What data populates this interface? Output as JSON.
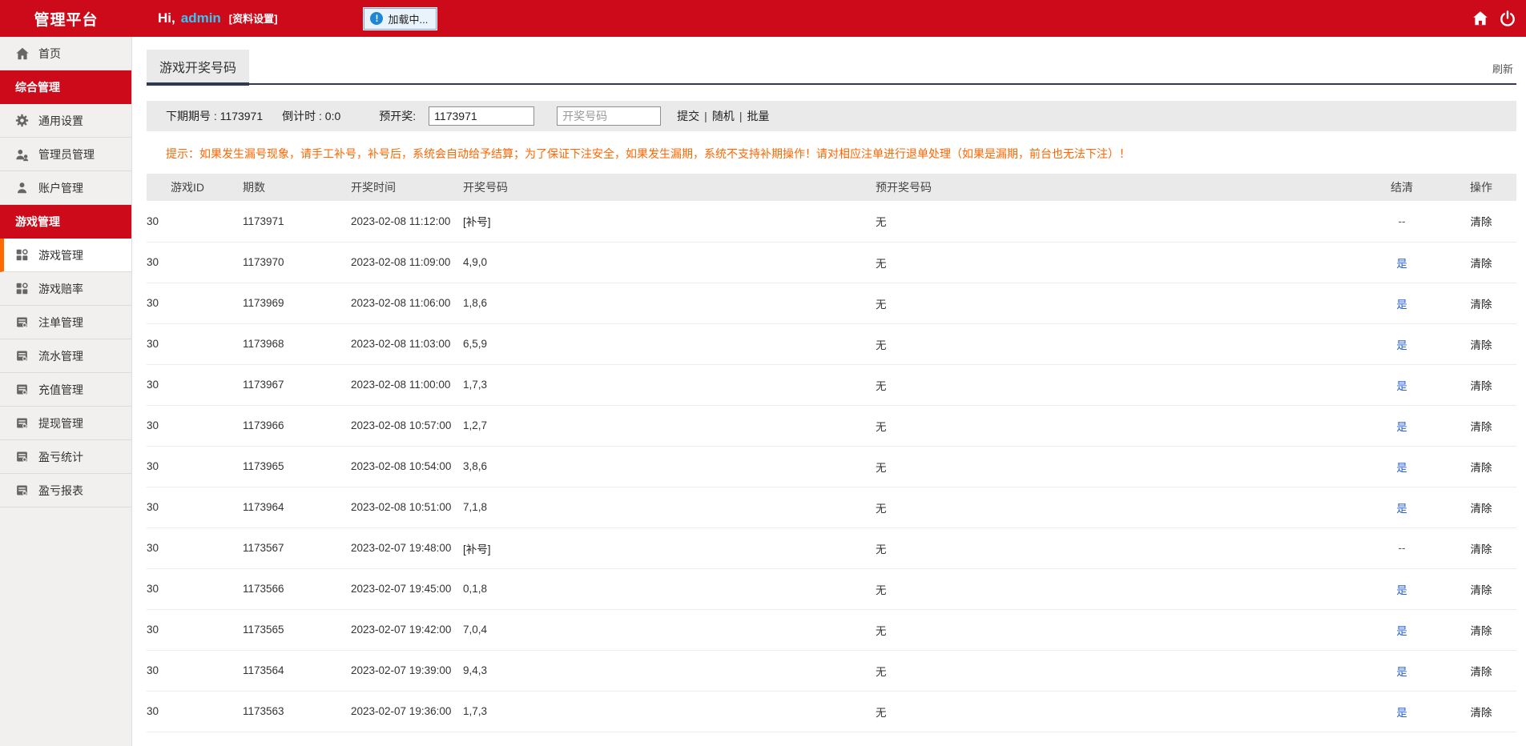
{
  "header": {
    "title": "管理平台",
    "greeting_prefix": "Hi,",
    "username": "admin",
    "profile_link": "[资料设置]",
    "loading_text": "加载中..."
  },
  "sidebar": {
    "items": [
      {
        "type": "link",
        "name": "home",
        "icon": "home",
        "label": "首页",
        "active": false
      },
      {
        "type": "section",
        "name": "general-management",
        "label": "综合管理"
      },
      {
        "type": "link",
        "name": "general-settings",
        "icon": "gear",
        "label": "通用设置",
        "active": false
      },
      {
        "type": "link",
        "name": "admin-management",
        "icon": "users",
        "label": "管理员管理",
        "active": false
      },
      {
        "type": "link",
        "name": "account-management",
        "icon": "user",
        "label": "账户管理",
        "active": false
      },
      {
        "type": "section",
        "name": "game-management",
        "label": "游戏管理"
      },
      {
        "type": "link",
        "name": "game-management",
        "icon": "grid",
        "label": "游戏管理",
        "active": true
      },
      {
        "type": "link",
        "name": "game-odds",
        "icon": "grid",
        "label": "游戏赔率",
        "active": false
      },
      {
        "type": "link",
        "name": "bet-management",
        "icon": "doc",
        "label": "注单管理",
        "active": false
      },
      {
        "type": "link",
        "name": "turnover-management",
        "icon": "doc",
        "label": "流水管理",
        "active": false
      },
      {
        "type": "link",
        "name": "recharge-management",
        "icon": "doc",
        "label": "充值管理",
        "active": false
      },
      {
        "type": "link",
        "name": "withdraw-management",
        "icon": "doc",
        "label": "提现管理",
        "active": false
      },
      {
        "type": "link",
        "name": "profit-statistics",
        "icon": "doc",
        "label": "盈亏统计",
        "active": false
      },
      {
        "type": "link",
        "name": "profit-report",
        "icon": "doc",
        "label": "盈亏报表",
        "active": false
      }
    ]
  },
  "main": {
    "tab_label": "游戏开奖号码",
    "refresh_label": "刷新",
    "form": {
      "next_issue": "下期期号 : 1173971",
      "countdown": "倒计时 : 0:0",
      "predraw_label": "预开奖:",
      "issue_value": "1173971",
      "number_placeholder": "开奖号码",
      "actions": [
        "提交",
        "随机",
        "批量"
      ],
      "separator": "|"
    },
    "notice": "提示：如果发生漏号现象，请手工补号，补号后，系统会自动给予结算；为了保证下注安全，如果发生漏期，系统不支持补期操作！请对相应注单进行退单处理（如果是漏期，前台也无法下注）！",
    "table": {
      "columns": [
        "游戏ID",
        "期数",
        "开奖时间",
        "开奖号码",
        "预开奖号码",
        "结清",
        "操作"
      ],
      "rows": [
        {
          "game_id": "30",
          "issue": "1173971",
          "time": "2023-02-08 11:12:00",
          "numbers": "[补号]",
          "is_makeup": true,
          "predraw": "无",
          "settled": "--",
          "action": "清除"
        },
        {
          "game_id": "30",
          "issue": "1173970",
          "time": "2023-02-08 11:09:00",
          "numbers": "4,9,0",
          "is_makeup": false,
          "predraw": "无",
          "settled": "是",
          "action": "清除"
        },
        {
          "game_id": "30",
          "issue": "1173969",
          "time": "2023-02-08 11:06:00",
          "numbers": "1,8,6",
          "is_makeup": false,
          "predraw": "无",
          "settled": "是",
          "action": "清除"
        },
        {
          "game_id": "30",
          "issue": "1173968",
          "time": "2023-02-08 11:03:00",
          "numbers": "6,5,9",
          "is_makeup": false,
          "predraw": "无",
          "settled": "是",
          "action": "清除"
        },
        {
          "game_id": "30",
          "issue": "1173967",
          "time": "2023-02-08 11:00:00",
          "numbers": "1,7,3",
          "is_makeup": false,
          "predraw": "无",
          "settled": "是",
          "action": "清除"
        },
        {
          "game_id": "30",
          "issue": "1173966",
          "time": "2023-02-08 10:57:00",
          "numbers": "1,2,7",
          "is_makeup": false,
          "predraw": "无",
          "settled": "是",
          "action": "清除"
        },
        {
          "game_id": "30",
          "issue": "1173965",
          "time": "2023-02-08 10:54:00",
          "numbers": "3,8,6",
          "is_makeup": false,
          "predraw": "无",
          "settled": "是",
          "action": "清除"
        },
        {
          "game_id": "30",
          "issue": "1173964",
          "time": "2023-02-08 10:51:00",
          "numbers": "7,1,8",
          "is_makeup": false,
          "predraw": "无",
          "settled": "是",
          "action": "清除"
        },
        {
          "game_id": "30",
          "issue": "1173567",
          "time": "2023-02-07 19:48:00",
          "numbers": "[补号]",
          "is_makeup": true,
          "predraw": "无",
          "settled": "--",
          "action": "清除"
        },
        {
          "game_id": "30",
          "issue": "1173566",
          "time": "2023-02-07 19:45:00",
          "numbers": "0,1,8",
          "is_makeup": false,
          "predraw": "无",
          "settled": "是",
          "action": "清除"
        },
        {
          "game_id": "30",
          "issue": "1173565",
          "time": "2023-02-07 19:42:00",
          "numbers": "7,0,4",
          "is_makeup": false,
          "predraw": "无",
          "settled": "是",
          "action": "清除"
        },
        {
          "game_id": "30",
          "issue": "1173564",
          "time": "2023-02-07 19:39:00",
          "numbers": "9,4,3",
          "is_makeup": false,
          "predraw": "无",
          "settled": "是",
          "action": "清除"
        },
        {
          "game_id": "30",
          "issue": "1173563",
          "time": "2023-02-07 19:36:00",
          "numbers": "1,7,3",
          "is_makeup": false,
          "predraw": "无",
          "settled": "是",
          "action": "清除"
        }
      ]
    }
  },
  "colors": {
    "header_red": "#cc0a1a",
    "active_orange": "#ff6a00",
    "link_blue": "#2b5fd9",
    "notice_orange": "#ff6600",
    "tab_underline": "#2e3a50",
    "panel_gray": "#eaeaea"
  }
}
